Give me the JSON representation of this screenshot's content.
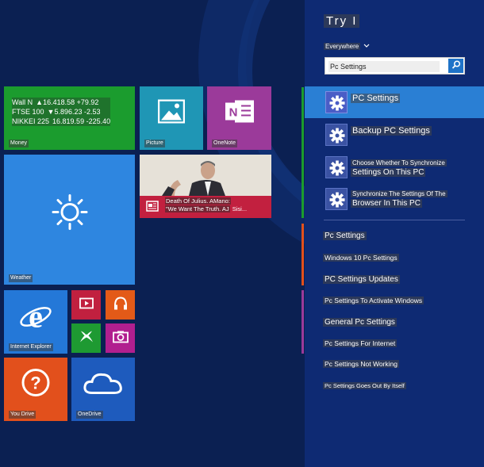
{
  "colors": {
    "money_tile": "#1b9c2e",
    "photos_tile": "#1f96b5",
    "onenote_tile": "#9b3a9a",
    "weather_tile": "#2e86e0",
    "ie_tile": "#2478d8",
    "video_tile": "#c1203f",
    "music_tile": "#e35a18",
    "games_tile": "#1e9a32",
    "camera_tile": "#b11f8f",
    "help_tile": "#e2501c",
    "onedrive_tile": "#1e5bbd",
    "charm_bg": "#0e2a73",
    "selected": "#2a7fd4"
  },
  "tiles": {
    "money": {
      "label": "Money",
      "rows": [
        {
          "name": "Wall N",
          "value": "▲16.418.58 +79.92"
        },
        {
          "name": "FTSE 100",
          "value": "▼5.896.23 -2.53"
        },
        {
          "name": "NIKKEI 225",
          "value": "16.819.59 -225.40"
        }
      ]
    },
    "photos": {
      "label": "Picture",
      "icon": "picture-icon"
    },
    "onenote": {
      "label": "OneNote",
      "icon": "onenote-icon"
    },
    "news": {
      "caption_line1": "Death Of Julius. AMano:",
      "caption_line2": "\"We Want The Truth. AJ",
      "caption_tail": "Sisi..."
    },
    "weather": {
      "label": "Weather",
      "icon": "sun-icon"
    },
    "ie": {
      "label": "Internet Explorer",
      "icon": "internet-explorer-icon"
    },
    "video": {
      "icon": "video-icon"
    },
    "music": {
      "icon": "headphones-icon"
    },
    "games": {
      "icon": "xbox-icon"
    },
    "camera": {
      "icon": "camera-icon"
    },
    "help": {
      "label": "You Drive",
      "icon": "question-icon"
    },
    "onedrive": {
      "label": "OneDrive",
      "icon": "cloud-icon"
    }
  },
  "charm": {
    "title": "Try I",
    "scope": "Everywhere",
    "search": {
      "value": "Pc Settings"
    },
    "results": [
      {
        "label": "PC Settings",
        "selected": true
      },
      {
        "label": "Backup PC Settings",
        "selected": false
      },
      {
        "line1": "Choose Whether To Synchronize",
        "line2": "Settings On This PC",
        "selected": false
      },
      {
        "line1": "Synchronize The Settings Of The",
        "line2": "Browser In This PC",
        "selected": false
      }
    ],
    "suggestions": [
      "Pc Settings",
      "Windows 10 Pc Settings",
      "PC Settings Updates",
      "Pc Settings To Activate Windows",
      "General Pc Settings",
      "Pc Settings For Internet",
      "Pc Settings Not Working",
      "Pc Settings Goes Out By Itself"
    ]
  }
}
